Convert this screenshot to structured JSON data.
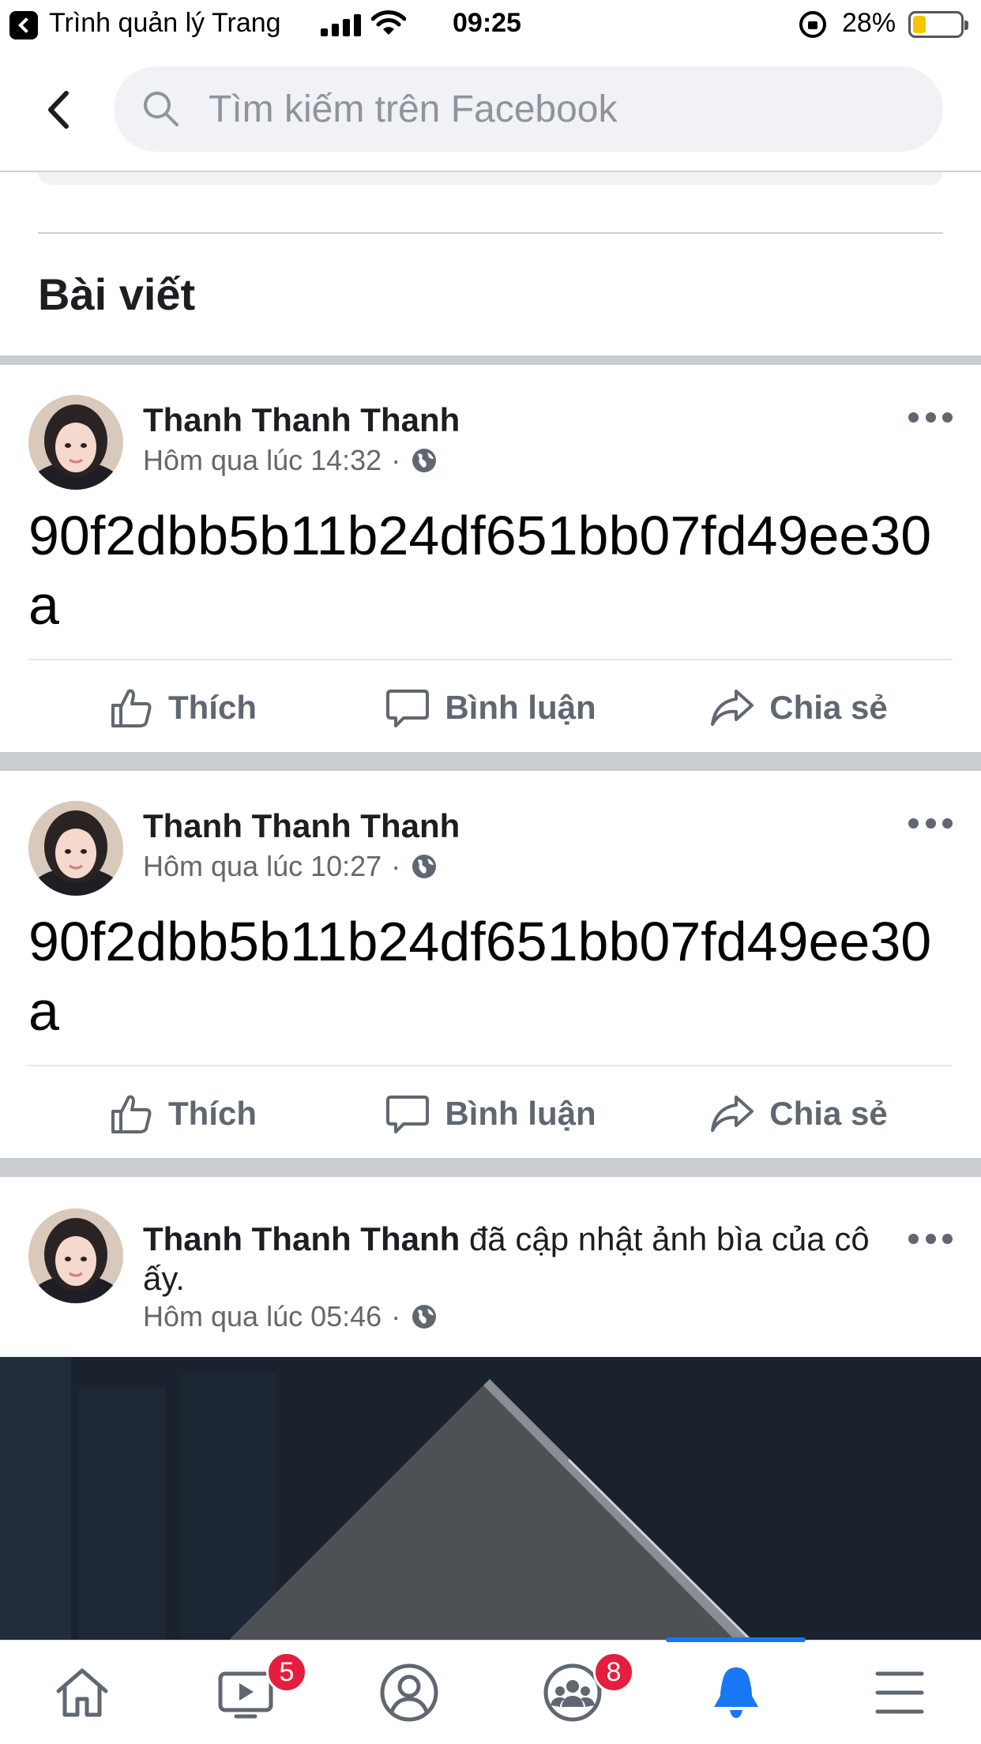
{
  "status_bar": {
    "back_app_label": "Trình quản lý Trang",
    "time": "09:25",
    "battery_percent": "28%",
    "battery_level": 0.28,
    "battery_color": "#f5c500"
  },
  "search": {
    "placeholder": "Tìm kiếm trên Facebook",
    "value": ""
  },
  "section_title": "Bài viết",
  "posts": [
    {
      "author": "Thanh Thanh Thanh",
      "time": "Hôm qua lúc 14:32",
      "privacy_separator": "·",
      "privacy_icon": "globe-icon",
      "text": "90f2dbb5b11b24df651bb07fd49ee30a"
    },
    {
      "author": "Thanh Thanh Thanh",
      "time": "Hôm qua lúc 10:27",
      "privacy_separator": "·",
      "privacy_icon": "globe-icon",
      "text": "90f2dbb5b11b24df651bb07fd49ee30a"
    },
    {
      "author": "Thanh Thanh Thanh",
      "action_text": "đã cập nhật ảnh bìa của cô ấy.",
      "time": "Hôm qua lúc 05:46",
      "privacy_separator": "·",
      "privacy_icon": "globe-icon"
    }
  ],
  "post_actions": {
    "like": "Thích",
    "comment": "Bình luận",
    "share": "Chia sẻ"
  },
  "tab_bar": {
    "tabs": [
      {
        "name": "home",
        "icon": "home-icon"
      },
      {
        "name": "watch",
        "icon": "video-icon",
        "badge": "5"
      },
      {
        "name": "profile",
        "icon": "profile-icon"
      },
      {
        "name": "groups",
        "icon": "groups-icon",
        "badge": "8"
      },
      {
        "name": "notifications",
        "icon": "bell-icon",
        "active": true
      },
      {
        "name": "menu",
        "icon": "menu-icon"
      }
    ],
    "active_color": "#1877f2",
    "badge_color": "#e41e3f"
  }
}
